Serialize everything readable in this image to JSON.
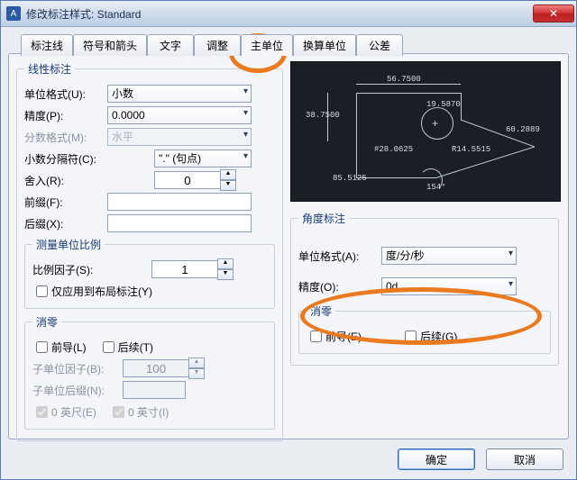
{
  "window": {
    "title": "修改标注样式: Standard",
    "close": "✕"
  },
  "tabs": {
    "items": [
      "标注线",
      "符号和箭头",
      "文字",
      "调整",
      "主单位",
      "换算单位",
      "公差"
    ],
    "active": 4
  },
  "linear": {
    "legend": "线性标注",
    "unit_format": {
      "label": "单位格式(U):",
      "value": "小数"
    },
    "precision": {
      "label": "精度(P):",
      "value": "0.0000"
    },
    "fraction_format": {
      "label": "分数格式(M):",
      "value": "水平"
    },
    "decimal_sep": {
      "label": "小数分隔符(C):",
      "value": "\".\" (句点)"
    },
    "round": {
      "label": "舍入(R):",
      "value": "0"
    },
    "prefix": {
      "label": "前缀(F):",
      "value": ""
    },
    "suffix": {
      "label": "后缀(X):",
      "value": ""
    }
  },
  "scale": {
    "legend": "测量单位比例",
    "factor_label": "比例因子(S):",
    "factor": "1",
    "layout_only": "仅应用到布局标注(Y)"
  },
  "zero_l": {
    "legend": "消零",
    "lead": "前导(L)",
    "trail": "后续(T)",
    "sub_factor": "子单位因子(B):",
    "sub_factor_val": "100",
    "sub_suffix": "子单位后缀(N):",
    "sub_suffix_val": "",
    "feet": "0 英尺(E)",
    "inch": "0 英寸(I)"
  },
  "ang": {
    "legend": "角度标注",
    "unit_format": {
      "label": "单位格式(A):",
      "value": "度/分/秒"
    },
    "precision": {
      "label": "精度(O):",
      "value": "0d"
    }
  },
  "zero_a": {
    "legend": "消零",
    "lead": "前导(E)",
    "trail": "后续(G)"
  },
  "preview": {
    "d1": "56.7500",
    "d2": "38.7500",
    "d3": "19.5870",
    "cross": "+",
    "d4": "#28.0625",
    "d5": "R14.5515",
    "d6": "60.2889",
    "d7": "85.5125",
    "d8": "154°"
  },
  "buttons": {
    "ok": "确定",
    "cancel": "取消"
  }
}
